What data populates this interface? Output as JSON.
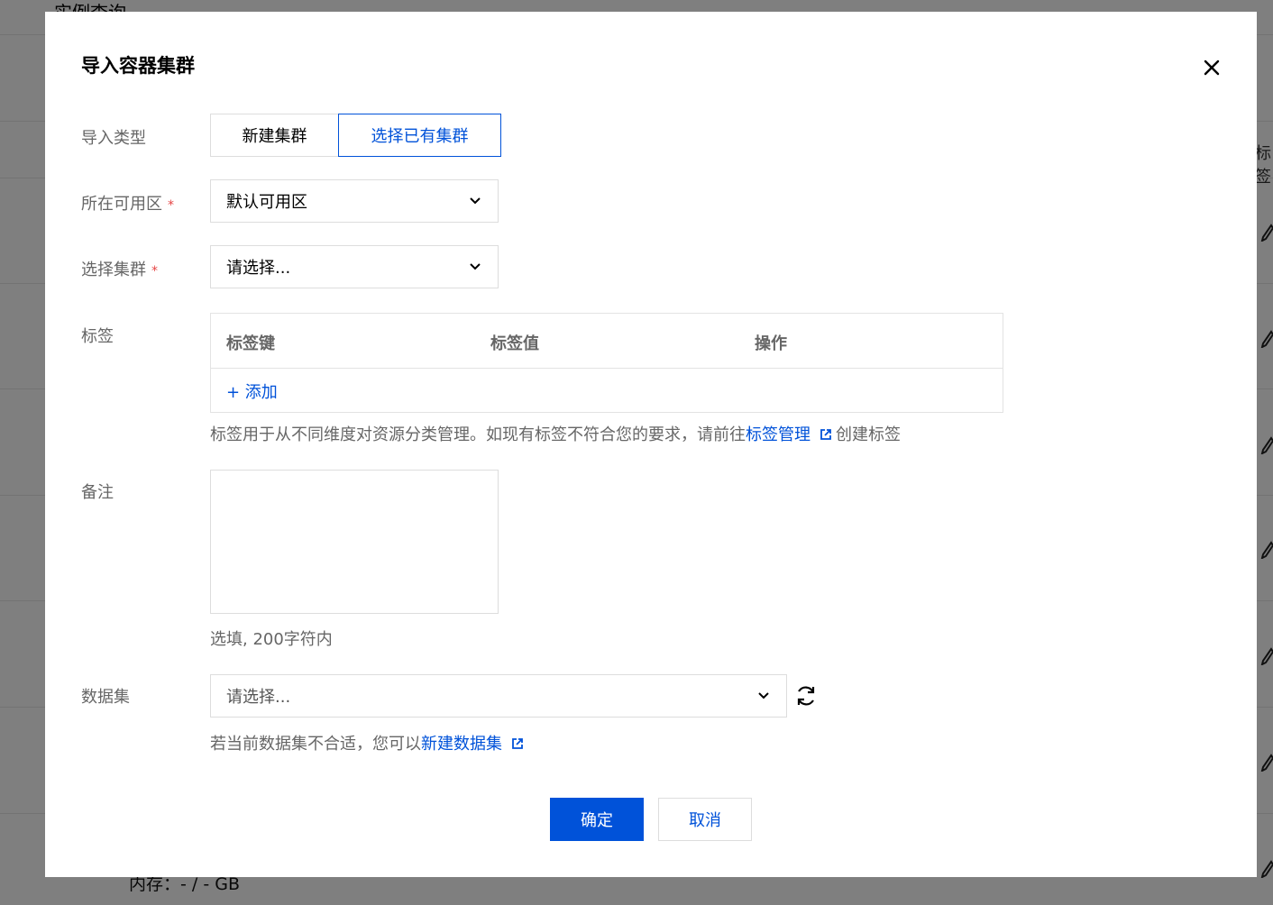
{
  "background": {
    "page_title": "实例查询",
    "right_label": "标签",
    "bottom_text": "内存：- / - GB"
  },
  "dialog": {
    "title": "导入容器集群",
    "close_icon": "close-icon",
    "import_type": {
      "label": "导入类型",
      "options": [
        "新建集群",
        "选择已有集群"
      ],
      "selected": "选择已有集群"
    },
    "zone": {
      "label": "所在可用区",
      "required_mark": "*",
      "value": "默认可用区"
    },
    "cluster": {
      "label": "选择集群",
      "required_mark": "*",
      "value": "请选择..."
    },
    "tags": {
      "label": "标签",
      "columns": [
        "标签键",
        "标签值",
        "操作"
      ],
      "add_label": "+ 添加",
      "help_prefix": "标签用于从不同维度对资源分类管理。如现有标签不符合您的要求，请前往",
      "help_link": "标签管理",
      "help_suffix": "创建标签"
    },
    "remark": {
      "label": "备注",
      "value": "",
      "hint": "选填, 200字符内"
    },
    "dataset": {
      "label": "数据集",
      "placeholder": "请选择...",
      "help_prefix": "若当前数据集不合适，您可以",
      "help_link": "新建数据集"
    },
    "buttons": {
      "confirm": "确定",
      "cancel": "取消"
    },
    "colors": {
      "primary": "#0052d9",
      "required": "#e54545"
    }
  }
}
